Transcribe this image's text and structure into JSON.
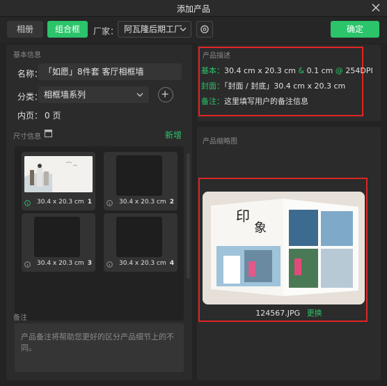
{
  "window": {
    "title": "添加产品"
  },
  "toolbar": {
    "album_label": "相册",
    "combo_label": "组合框",
    "factory_label": "厂家：",
    "factory_value": "阿瓦隆后期工厂",
    "confirm_label": "确定"
  },
  "basic": {
    "section_title": "基本信息",
    "name_label": "名称：",
    "name_value": "「如愿」8件套 客厅相框墙",
    "category_label": "分类：",
    "category_value": "相框墙系列",
    "pages_label": "内页：",
    "pages_value": "0 页"
  },
  "size_info": {
    "section_title": "尺寸信息",
    "add_new_label": "新增",
    "cells": [
      {
        "size": "30.4 x 20.3 cm",
        "num": "1"
      },
      {
        "size": "30.4 x 20.3 cm",
        "num": "2"
      },
      {
        "size": "30.4 x 20.3 cm",
        "num": "3"
      },
      {
        "size": "30.4 x 20.3 cm",
        "num": "4"
      }
    ]
  },
  "notes": {
    "section_title": "备注",
    "placeholder": "产品备注将帮助您更好的区分产品细节上的不同。"
  },
  "description": {
    "section_title": "产品描述",
    "basic_label": "基本：",
    "basic_dims": "30.4 cm x 20.3 cm",
    "amp": "&",
    "thickness": "0.1 cm",
    "at": "@",
    "dpi": "254DPI",
    "cover_label": "封面：",
    "cover_value": "「封面 / 封底」30.4 cm x 20.3 cm",
    "note_label": "备注：",
    "note_value": "这里填写用户的备注信息"
  },
  "thumbnail": {
    "section_title": "产品缩略图",
    "file_name": "124567.JPG",
    "replace_label": "更换"
  },
  "colors": {
    "accent": "#2bc46a",
    "highlight": "#e02424",
    "panel": "#2b2b2b"
  }
}
